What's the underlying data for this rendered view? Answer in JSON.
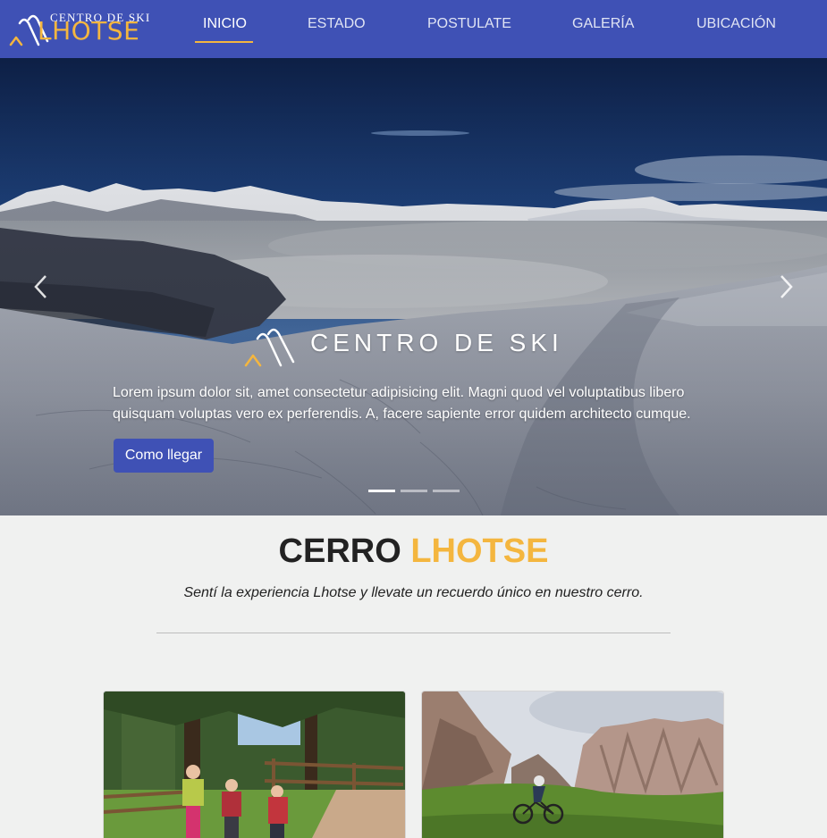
{
  "brand": {
    "top_text": "CENTRO DE SKI",
    "main_text": "LHOTSE",
    "accent_color": "#f4b63f",
    "nav_color": "#3f51b5"
  },
  "nav": {
    "items": [
      {
        "label": "INICIO",
        "active": true
      },
      {
        "label": "ESTADO",
        "active": false
      },
      {
        "label": "POSTULATE",
        "active": false
      },
      {
        "label": "GALERÍA",
        "active": false
      },
      {
        "label": "UBICACIÓN",
        "active": false
      }
    ]
  },
  "hero": {
    "title": "CENTRO DE SKI",
    "text": "Lorem ipsum dolor sit, amet consectetur adipisicing elit. Magni quod vel voluptatibus libero quisquam voluptas vero ex perferendis. A, facere sapiente error quidem architecto cumque.",
    "button_label": "Como llegar",
    "prev_icon": "chevron-left-icon",
    "next_icon": "chevron-right-icon",
    "slides": 3,
    "active_slide": 1
  },
  "section": {
    "title_main": "CERRO",
    "title_accent": "LHOTSE",
    "subtitle": "Sentí la experiencia Lhotse y llevate un recuerdo único en nuestro cerro."
  }
}
